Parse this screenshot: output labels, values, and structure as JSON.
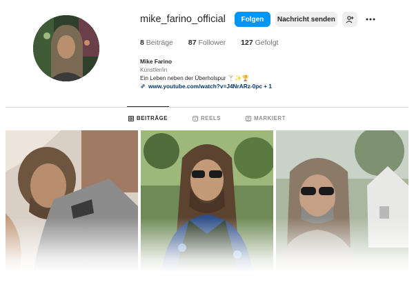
{
  "profile": {
    "username": "mike_farino_official",
    "follow_label": "Folgen",
    "message_label": "Nachricht senden",
    "add_user_icon": "person-add-icon",
    "more_icon": "more-horizontal-icon"
  },
  "stats": {
    "posts_count": "8",
    "posts_label": "Beiträge",
    "followers_count": "87",
    "followers_label": "Follower",
    "following_count": "127",
    "following_label": "Gefolgt"
  },
  "bio": {
    "name": "Mike Farino",
    "category": "Künstler/in",
    "text": "Ein Leben neben der Überholspur 🍸✨🏆",
    "link": "www.youtube.com/watch?v=J4NrARz-0pc + 1"
  },
  "tabs": [
    {
      "label": "BEITRÄGE",
      "icon": "grid-icon",
      "active": true
    },
    {
      "label": "REELS",
      "icon": "reels-icon",
      "active": false
    },
    {
      "label": "MARKIERT",
      "icon": "tagged-icon",
      "active": false
    }
  ],
  "colors": {
    "accent": "#0095f6",
    "link": "#00376b",
    "muted": "#737373"
  }
}
